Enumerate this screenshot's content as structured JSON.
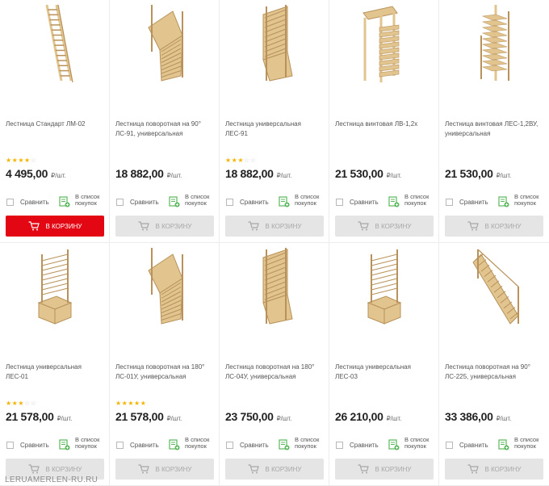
{
  "products": [
    {
      "title": "Лестница Стандарт ЛМ-02",
      "price": "4 495,00",
      "unit": "₽/шт.",
      "stars": 4,
      "button_active": true,
      "shape": "straight"
    },
    {
      "title": "Лестница поворотная на 90° ЛС-91, универсальная",
      "price": "18 882,00",
      "unit": "₽/шт.",
      "stars": 0,
      "button_active": false,
      "shape": "turn"
    },
    {
      "title": "Лестница универсальная ЛЕС-91",
      "price": "18 882,00",
      "unit": "₽/шт.",
      "stars": 3,
      "button_active": false,
      "shape": "turnpost"
    },
    {
      "title": "Лестница винтовая ЛВ-1,2х",
      "price": "21 530,00",
      "unit": "₽/шт.",
      "stars": 0,
      "button_active": false,
      "shape": "spiral"
    },
    {
      "title": "Лестница винтовая ЛЕС-1,2ВУ, универсальная",
      "price": "21 530,00",
      "unit": "₽/шт.",
      "stars": 0,
      "button_active": false,
      "shape": "spiral2"
    },
    {
      "title": "Лестница универсальная ЛЕС-01",
      "price": "21 578,00",
      "unit": "₽/шт.",
      "stars": 3,
      "button_active": false,
      "shape": "lshape"
    },
    {
      "title": "Лестница поворотная на 180° ЛС-01У, универсальная",
      "price": "21 578,00",
      "unit": "₽/шт.",
      "stars": 5,
      "button_active": false,
      "shape": "turn"
    },
    {
      "title": "Лестница поворотная на 180° ЛС-04У, универсальная",
      "price": "23 750,00",
      "unit": "₽/шт.",
      "stars": 0,
      "button_active": false,
      "shape": "turnpost"
    },
    {
      "title": "Лестница универсальная ЛЕС-03",
      "price": "26 210,00",
      "unit": "₽/шт.",
      "stars": 0,
      "button_active": false,
      "shape": "lshape"
    },
    {
      "title": "Лестница поворотная на 90° ЛС-225, универсальная",
      "price": "33 386,00",
      "unit": "₽/шт.",
      "stars": 0,
      "button_active": false,
      "shape": "diag"
    }
  ],
  "labels": {
    "compare": "Сравнить",
    "wishlist": "В список покупок",
    "to_cart": "В КОРЗИНУ"
  },
  "colors": {
    "accent": "#e30613",
    "star": "#f4b400",
    "wood": "#e2c48f",
    "wood_dark": "#b8925a",
    "wishlist_green": "#5cb85c"
  },
  "watermark": "LERUAMERLEN-RU.RU"
}
